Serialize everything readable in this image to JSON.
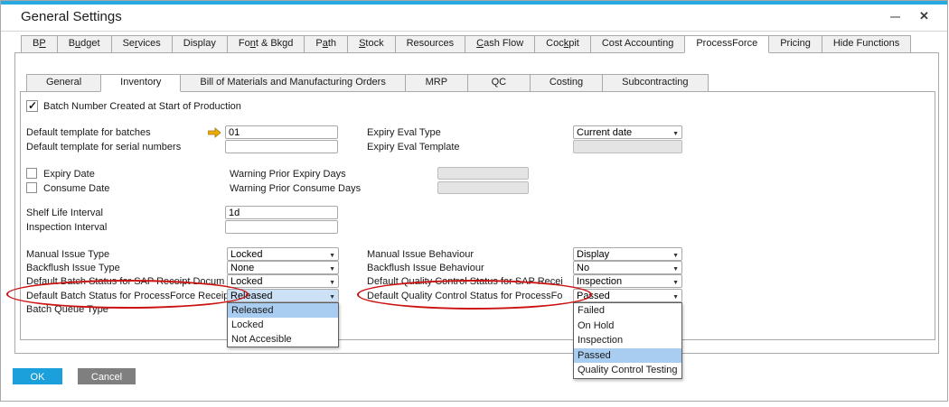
{
  "window": {
    "title": "General Settings"
  },
  "primary_tabs": [
    {
      "label": "BP",
      "u": 1
    },
    {
      "label": "Budget",
      "u": 1
    },
    {
      "label": "Services",
      "u": 2
    },
    {
      "label": "Display",
      "u": -1
    },
    {
      "label": "Font & Bkgd",
      "u": 2
    },
    {
      "label": "Path",
      "u": 1
    },
    {
      "label": "Stock",
      "u": 0
    },
    {
      "label": "Resources",
      "u": -1
    },
    {
      "label": "Cash Flow",
      "u": 0
    },
    {
      "label": "Cockpit",
      "u": 3
    },
    {
      "label": "Cost Accounting",
      "u": -1
    },
    {
      "label": "ProcessForce",
      "u": -1,
      "active": true
    },
    {
      "label": "Pricing",
      "u": -1
    },
    {
      "label": "Hide Functions",
      "u": -1
    }
  ],
  "secondary_tabs": [
    {
      "label": "General"
    },
    {
      "label": "Inventory",
      "active": true
    },
    {
      "label": "Bill of Materials and Manufacturing Orders"
    },
    {
      "label": "MRP"
    },
    {
      "label": "QC"
    },
    {
      "label": "Costing"
    },
    {
      "label": "Subcontracting"
    }
  ],
  "inventory": {
    "batch_created_checkbox": {
      "label": "Batch Number Created at Start of Production",
      "checked": true
    },
    "template_fields": [
      {
        "label": "Default template for batches",
        "value": "01"
      },
      {
        "label": "Default template for serial numbers",
        "value": ""
      }
    ],
    "expiry_fields": [
      {
        "label": "Expiry Eval Type",
        "value": "Current date"
      },
      {
        "label": "Expiry Eval Template",
        "value": "",
        "disabled": true
      }
    ],
    "date_checkboxes": [
      {
        "label": "Expiry Date",
        "checked": false,
        "warn_label": "Warning Prior Expiry Days",
        "warn_value": ""
      },
      {
        "label": "Consume Date",
        "checked": false,
        "warn_label": "Warning Prior Consume Days",
        "warn_value": ""
      }
    ],
    "interval_fields": [
      {
        "label": "Shelf Life Interval",
        "value": "1d"
      },
      {
        "label": "Inspection Interval",
        "value": ""
      }
    ],
    "issue_left": [
      {
        "label": "Manual Issue Type",
        "value": "Locked"
      },
      {
        "label": "Backflush Issue Type",
        "value": "None"
      },
      {
        "label": "Default Batch Status for SAP Receipt Docum",
        "value": "Locked"
      },
      {
        "label": "Default Batch Status for ProcessForce Receip",
        "value": "Released",
        "highlighted": true,
        "circled": true,
        "open": true
      },
      {
        "label": "Batch Queue Type",
        "value": null
      }
    ],
    "issue_right": [
      {
        "label": "Manual Issue Behaviour",
        "value": "Display"
      },
      {
        "label": "Backflush Issue Behaviour",
        "value": "No"
      },
      {
        "label": "Default Quality Control Status for SAP Recei",
        "value": "Inspection"
      },
      {
        "label": "Default Quality Control Status for ProcessFo",
        "value": "Passed",
        "circled": true,
        "open": true
      }
    ],
    "batch_status_dropdown": {
      "items": [
        "Released",
        "Locked",
        "Not Accesible"
      ],
      "selected": "Released"
    },
    "qc_status_dropdown": {
      "items": [
        "Failed",
        "On Hold",
        "Inspection",
        "Passed",
        "Quality Control Testing"
      ],
      "selected": "Passed"
    }
  },
  "footer": {
    "ok_label": "OK",
    "cancel_label": "Cancel"
  },
  "colors": {
    "titlebar_strip": "#29a9e1",
    "accent_blue": "#1ba0dc",
    "cancel_gray": "#7f7f7f",
    "highlight_blue": "#cde1f6",
    "dropdown_selected": "#a9cdf0",
    "annotation_red": "#cc1111",
    "disabled_bg": "#e4e4e4",
    "link_arrow_gold": "#f0ab00"
  }
}
